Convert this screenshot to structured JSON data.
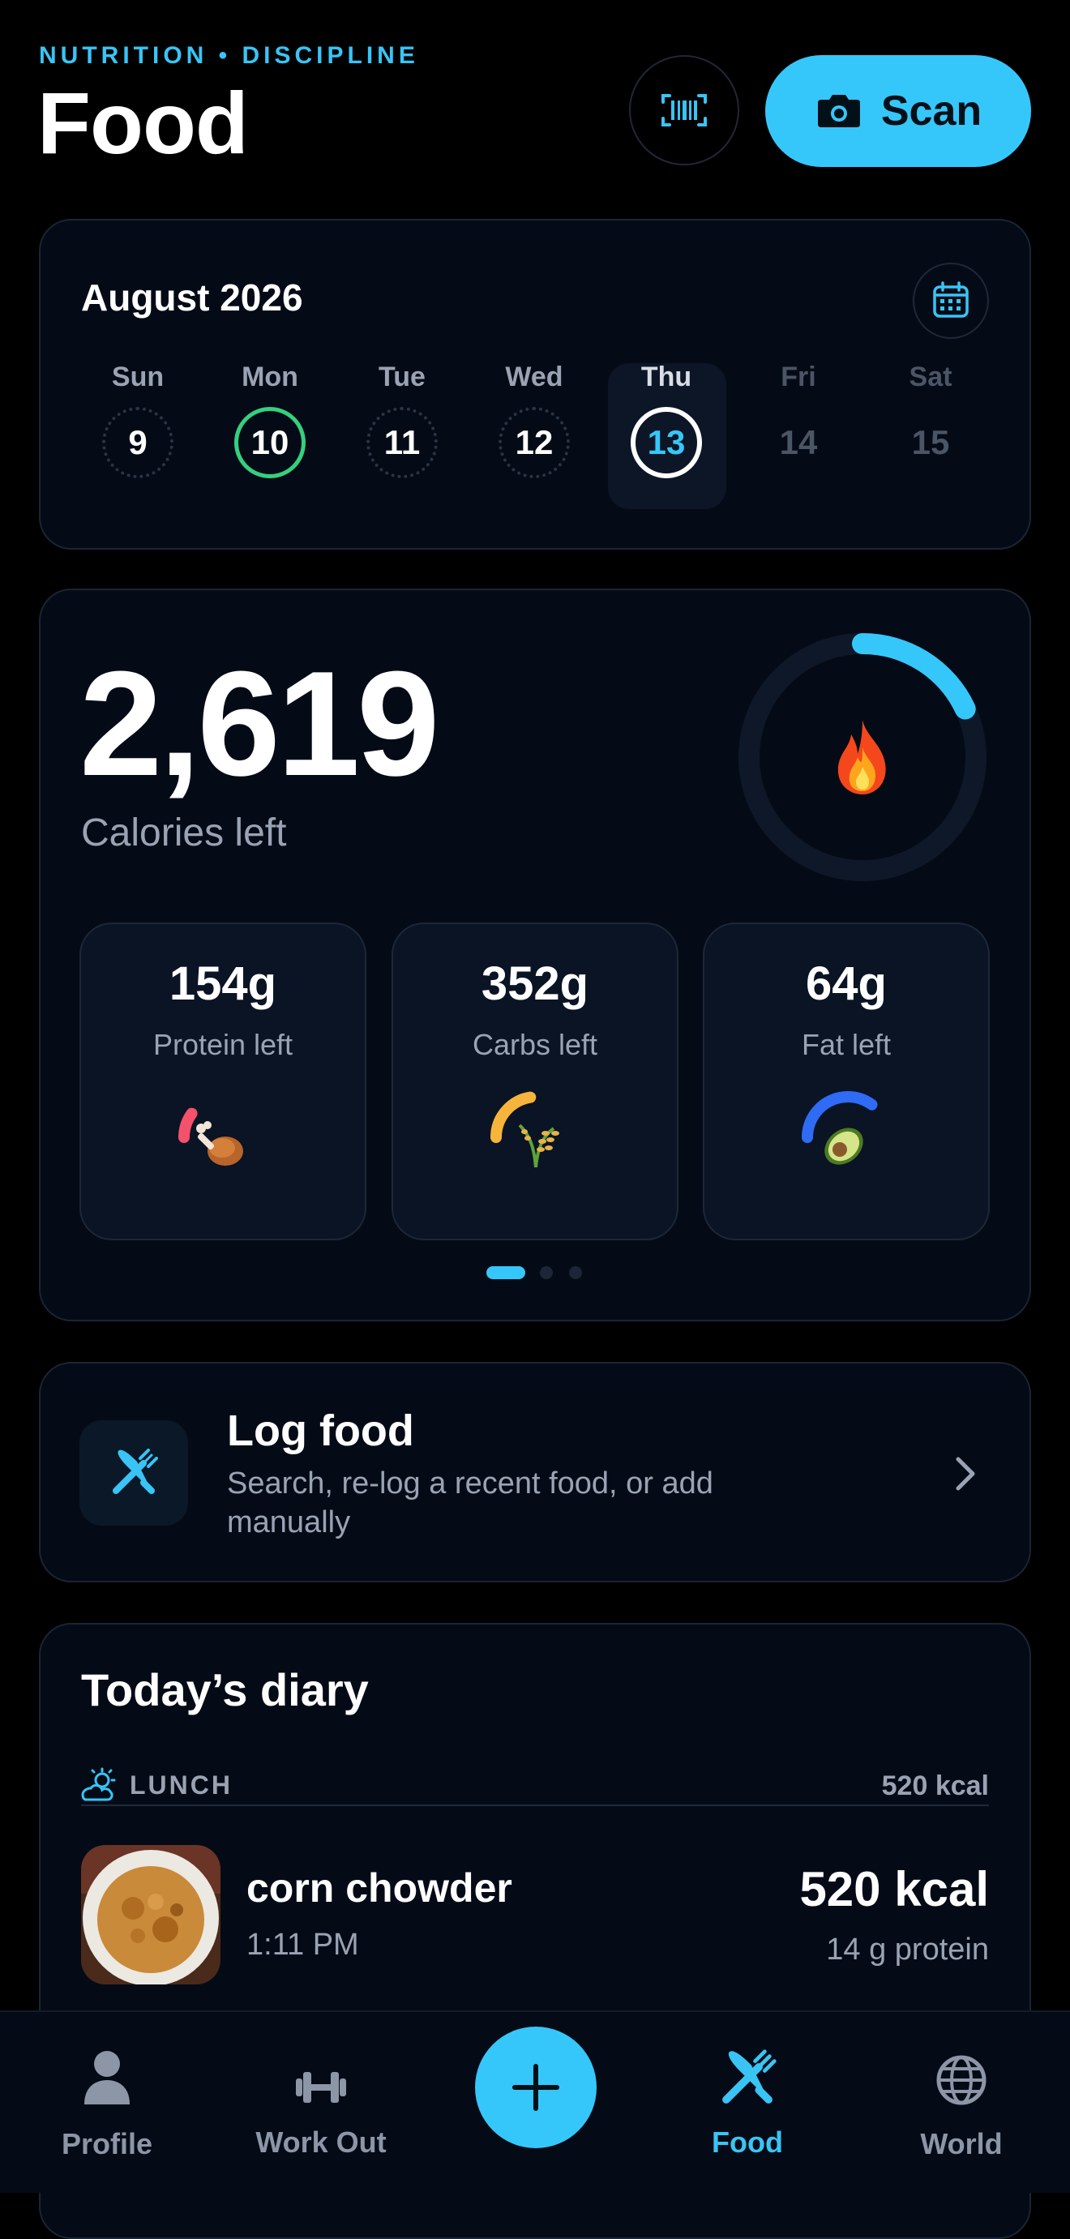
{
  "header": {
    "eyebrow": "NUTRITION • DISCIPLINE",
    "title": "Food",
    "scan_label": "Scan"
  },
  "calendar": {
    "month": "August 2026",
    "days": [
      {
        "name": "Sun",
        "num": "9",
        "state": "dotted"
      },
      {
        "name": "Mon",
        "num": "10",
        "state": "complete"
      },
      {
        "name": "Tue",
        "num": "11",
        "state": "dotted"
      },
      {
        "name": "Wed",
        "num": "12",
        "state": "dotted"
      },
      {
        "name": "Thu",
        "num": "13",
        "state": "selected"
      },
      {
        "name": "Fri",
        "num": "14",
        "state": "future"
      },
      {
        "name": "Sat",
        "num": "15",
        "state": "future"
      }
    ]
  },
  "calories": {
    "value": "2,619",
    "label": "Calories left",
    "ring_progress": 0.18,
    "icon": "fire-icon"
  },
  "macros": [
    {
      "value": "154g",
      "label": "Protein left",
      "color": "#f4516c",
      "progress": 0.2,
      "icon": "poultry-leg-icon"
    },
    {
      "value": "352g",
      "label": "Carbs left",
      "color": "#f7b43c",
      "progress": 0.45,
      "icon": "rice-icon"
    },
    {
      "value": "64g",
      "label": "Fat left",
      "color": "#2f6bf5",
      "progress": 0.7,
      "icon": "avocado-icon"
    }
  ],
  "pager": {
    "count": 3,
    "active": 0
  },
  "log_food": {
    "title": "Log food",
    "subtitle": "Search, re-log a recent food, or add manually"
  },
  "diary": {
    "title": "Today’s diary",
    "meals": [
      {
        "name": "LUNCH",
        "kcal": "520 kcal",
        "items": [
          {
            "name": "corn chowder",
            "time": "1:11 PM",
            "kcal": "520 kcal",
            "protein": "14 g protein"
          }
        ]
      }
    ]
  },
  "tabbar": {
    "tabs": [
      {
        "label": "Profile",
        "icon": "person-icon",
        "active": false
      },
      {
        "label": "Work Out",
        "icon": "dumbbell-icon",
        "active": false
      },
      {
        "label": "Food",
        "icon": "fork-knife-icon",
        "active": true
      },
      {
        "label": "World",
        "icon": "globe-icon",
        "active": false
      }
    ]
  },
  "colors": {
    "accent": "#36c7fa",
    "complete": "#35d07f",
    "background": "#000000",
    "card": "#050b16"
  }
}
